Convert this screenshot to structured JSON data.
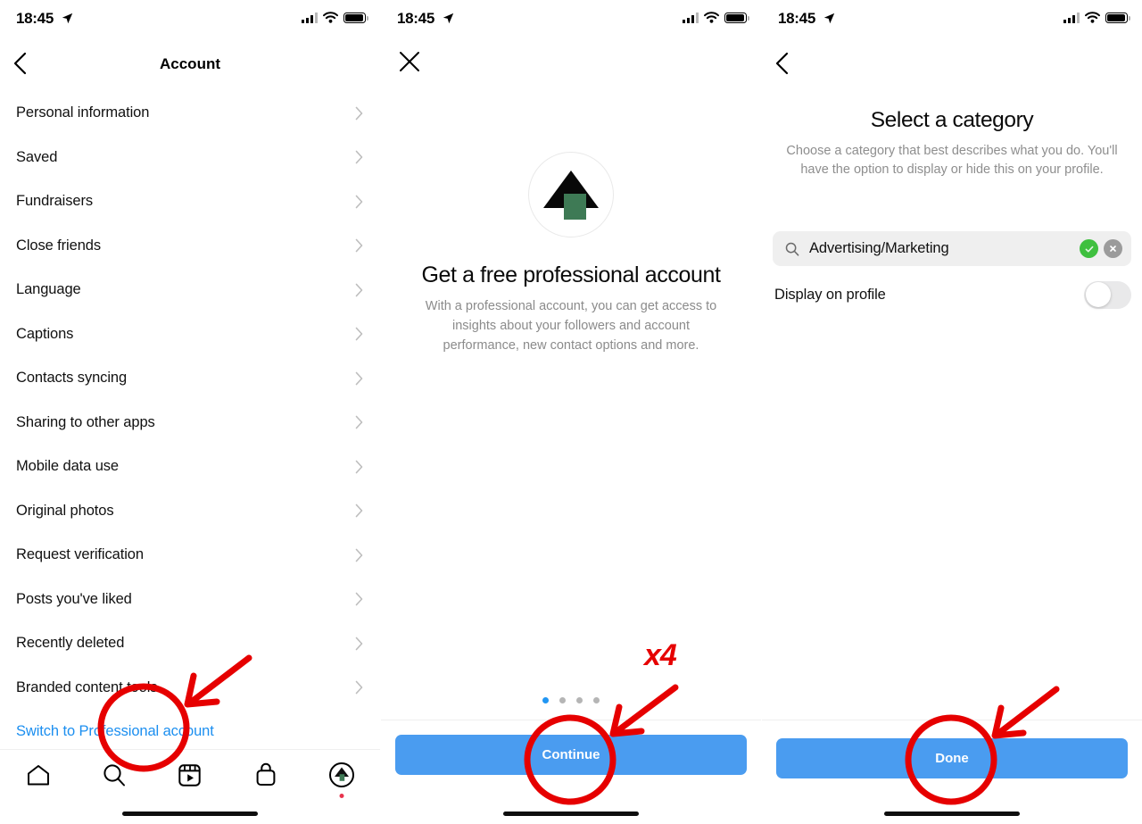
{
  "meta": {
    "accent_blue": "#4a9cf0",
    "link_blue": "#1c8ff0",
    "annotation_red": "#e60000",
    "green": "#3fc03f",
    "logo_green": "#3e7a55"
  },
  "status_bar": {
    "time": "18:45",
    "location_icon": "location-arrow-icon",
    "signal_icon": "cellular-signal-icon",
    "wifi_icon": "wifi-icon",
    "battery_icon": "battery-full-icon"
  },
  "panel_1": {
    "nav": {
      "back_icon": "chevron-left-icon",
      "title": "Account"
    },
    "items": [
      {
        "label": "Personal information"
      },
      {
        "label": "Saved"
      },
      {
        "label": "Fundraisers"
      },
      {
        "label": "Close friends"
      },
      {
        "label": "Language"
      },
      {
        "label": "Captions"
      },
      {
        "label": "Contacts syncing"
      },
      {
        "label": "Sharing to other apps"
      },
      {
        "label": "Mobile data use"
      },
      {
        "label": "Original photos"
      },
      {
        "label": "Request verification"
      },
      {
        "label": "Posts you've liked"
      },
      {
        "label": "Recently deleted"
      },
      {
        "label": "Branded content tools"
      }
    ],
    "switch_link": "Switch to Professional account",
    "tabs": [
      {
        "icon": "home-icon"
      },
      {
        "icon": "search-icon"
      },
      {
        "icon": "reels-icon"
      },
      {
        "icon": "shop-bag-icon"
      },
      {
        "icon": "profile-avatar-icon"
      }
    ]
  },
  "panel_2": {
    "nav": {
      "close_icon": "close-x-icon"
    },
    "logo_icon": "professional-account-icon",
    "title": "Get a free professional account",
    "subtitle": "With a professional account, you can get access to insights about your followers and account performance, new contact options and more.",
    "page_dots": {
      "count": 4,
      "active_index": 0
    },
    "cta_label": "Continue"
  },
  "panel_3": {
    "nav": {
      "back_icon": "chevron-left-icon"
    },
    "title": "Select a category",
    "subtitle": "Choose a category that best describes what you do. You'll have the option to display or hide this on your profile.",
    "search": {
      "icon": "search-icon",
      "value": "Advertising/Marketing",
      "placeholder": "Search",
      "confirm_icon": "check-circle-icon",
      "clear_icon": "clear-circle-icon"
    },
    "display_toggle": {
      "label": "Display on profile",
      "state": "off"
    },
    "cta_label": "Done"
  },
  "annotations": [
    {
      "name": "circle-switch-to-professional",
      "shape": "circle"
    },
    {
      "name": "arrow-to-switch-to-professional",
      "shape": "arrow"
    },
    {
      "name": "circle-continue-button",
      "shape": "circle"
    },
    {
      "name": "arrow-to-continue-button",
      "shape": "arrow"
    },
    {
      "name": "repeat-count-label",
      "shape": "text",
      "text": "x4"
    },
    {
      "name": "circle-done-button",
      "shape": "circle"
    },
    {
      "name": "arrow-to-done-button",
      "shape": "arrow"
    }
  ]
}
